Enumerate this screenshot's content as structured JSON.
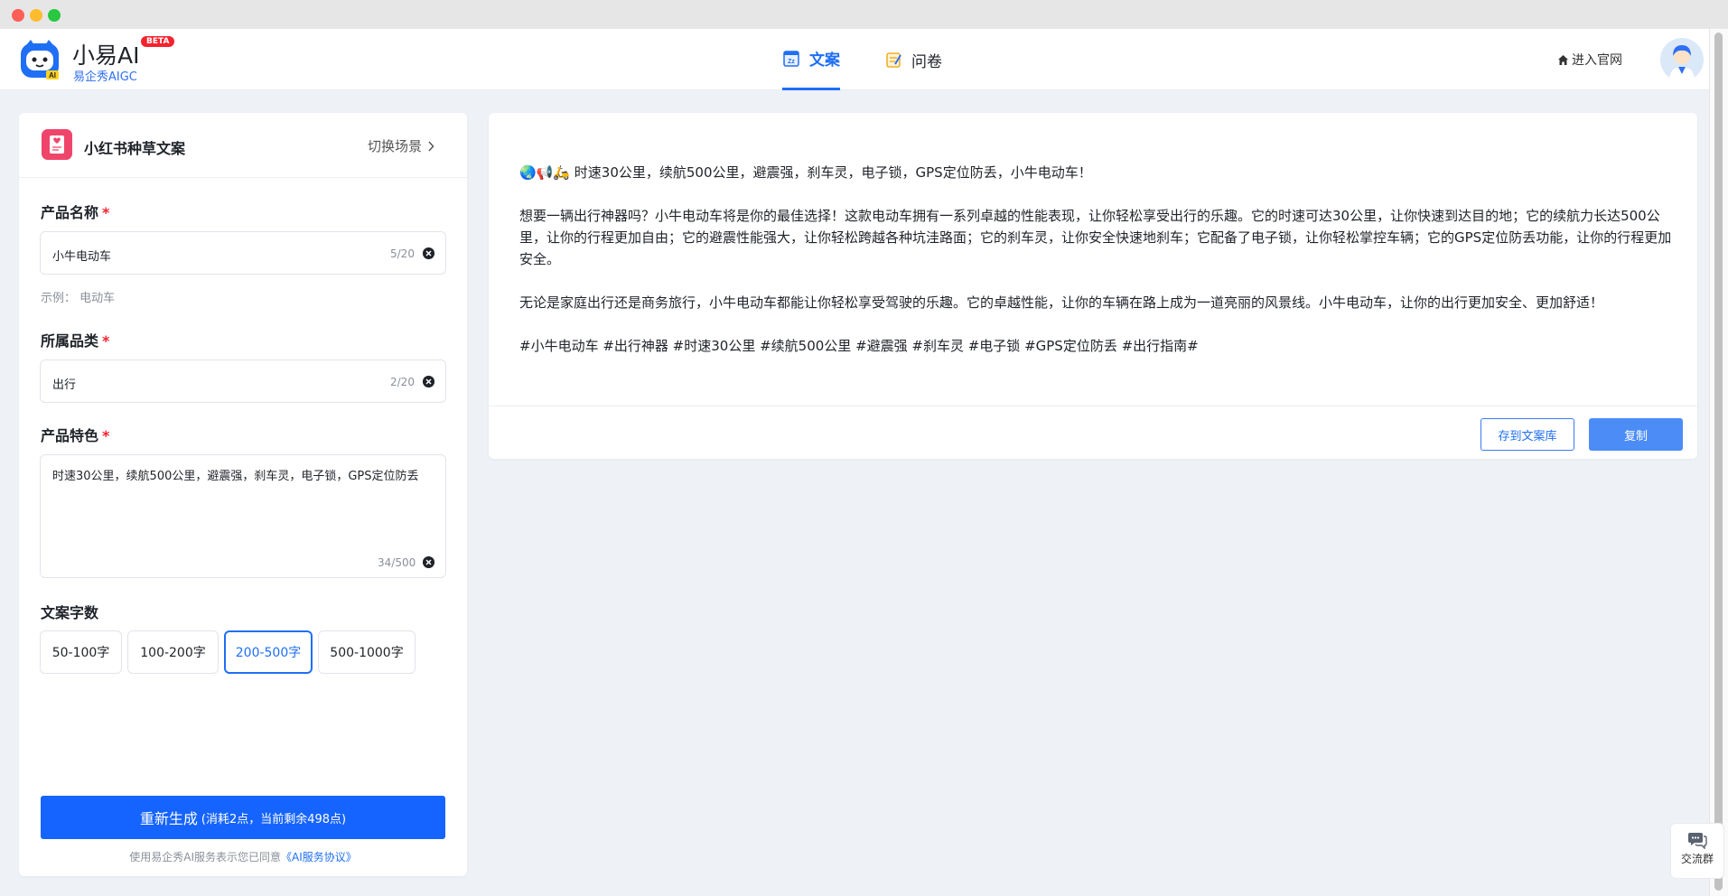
{
  "brand": {
    "name": "小易AI",
    "badge": "BETA",
    "subtitle": "易企秀AIGC"
  },
  "nav": {
    "tabs": [
      {
        "label": "文案",
        "active": true
      },
      {
        "label": "问卷",
        "active": false
      }
    ],
    "site_link": "进入官网"
  },
  "scene": {
    "title": "小红书种草文案",
    "switch_label": "切换场景"
  },
  "form": {
    "product_name": {
      "label": "产品名称",
      "value": "小牛电动车",
      "counter": "5/20",
      "hint": "示例：  电动车"
    },
    "category": {
      "label": "所属品类",
      "value": "出行",
      "counter": "2/20"
    },
    "features": {
      "label": "产品特色",
      "value": "时速30公里，续航500公里，避震强，刹车灵，电子锁，GPS定位防丢",
      "counter": "34/500"
    },
    "length": {
      "label": "文案字数",
      "options": [
        "50-100字",
        "100-200字",
        "200-500字",
        "500-1000字"
      ],
      "selected": "200-500字"
    },
    "generate": {
      "label": "重新生成",
      "note": "(消耗2点，当前剩余498点)"
    },
    "agreement": {
      "prefix": "使用易企秀AI服务表示您已同意",
      "link": "《AI服务协议》"
    }
  },
  "result": {
    "paragraphs": [
      "🌏📢🛵 时速30公里，续航500公里，避震强，刹车灵，电子锁，GPS定位防丢，小牛电动车！",
      "想要一辆出行神器吗？小牛电动车将是你的最佳选择！这款电动车拥有一系列卓越的性能表现，让你轻松享受出行的乐趣。它的时速可达30公里，让你快速到达目的地；它的续航力长达500公里，让你的行程更加自由；它的避震性能强大，让你轻松跨越各种坑洼路面；它的刹车灵，让你安全快速地刹车；它配备了电子锁，让你轻松掌控车辆；它的GPS定位防丢功能，让你的行程更加安全。",
      "无论是家庭出行还是商务旅行，小牛电动车都能让你轻松享受驾驶的乐趣。它的卓越性能，让你的车辆在路上成为一道亮丽的风景线。小牛电动车，让你的出行更加安全、更加舒适！",
      "#小牛电动车 #出行神器 #时速30公里 #续航500公里 #避震强 #刹车灵 #电子锁 #GPS定位防丢 #出行指南#"
    ],
    "save_label": "存到文案库",
    "copy_label": "复制"
  },
  "float": {
    "label": "交流群"
  }
}
